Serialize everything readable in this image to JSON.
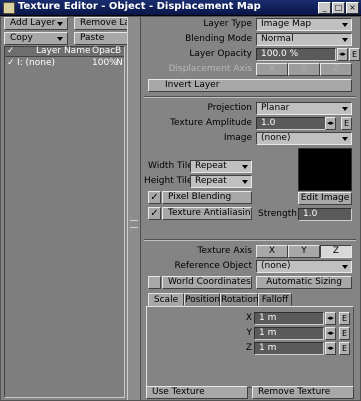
{
  "window": {
    "title": "Texture Editor - Object - Displacement Map",
    "min": "_",
    "max": "□",
    "close": "×"
  },
  "layers": {
    "add_layer": "Add Layer",
    "remove_layer": "Remove Layer",
    "copy": "Copy",
    "paste": "Paste",
    "columns": [
      "Layer Name",
      "Opac",
      "B"
    ],
    "rows": [
      {
        "check": "✓",
        "name": "I: (none)",
        "opacity": "100%",
        "blend": "N"
      }
    ],
    "header_check": "✓"
  },
  "layer_props": {
    "layer_type_label": "Layer Type",
    "layer_type_value": "Image Map",
    "blending_mode_label": "Blending Mode",
    "blending_mode_value": "Normal",
    "layer_opacity_label": "Layer Opacity",
    "layer_opacity_value": "100.0 %",
    "displacement_axis_label": "Displacement Axis",
    "axis_x": "X",
    "axis_y": "Y",
    "axis_z": "Z",
    "invert_layer": "Invert Layer",
    "env": "E"
  },
  "image_props": {
    "projection_label": "Projection",
    "projection_value": "Planar",
    "texture_amplitude_label": "Texture Amplitude",
    "texture_amplitude_value": "1.0",
    "image_label": "Image",
    "image_value": "(none)",
    "width_tile_label": "Width Tile",
    "width_tile_value": "Repeat",
    "height_tile_label": "Height Tile",
    "height_tile_value": "Repeat",
    "pixel_blending": "Pixel Blending",
    "texture_antialiasing": "Texture Antialiasing",
    "pixel_blending_check": "✓",
    "texture_antialiasing_check": "✓",
    "edit_image": "Edit Image",
    "strength_label": "Strength",
    "strength_value": "1.0"
  },
  "axis_props": {
    "texture_axis_label": "Texture Axis",
    "axis_x": "X",
    "axis_y": "Y",
    "axis_z": "Z",
    "reference_object_label": "Reference Object",
    "reference_object_value": "(none)",
    "world_coordinates": "World Coordinates",
    "world_coordinates_check": "",
    "automatic_sizing": "Automatic Sizing",
    "tabs": [
      "Scale",
      "Position",
      "Rotation",
      "Falloff"
    ],
    "scale": [
      {
        "axis": "X",
        "value": "1 m"
      },
      {
        "axis": "Y",
        "value": "1 m"
      },
      {
        "axis": "Z",
        "value": "1 m"
      }
    ]
  },
  "footer": {
    "use_texture": "Use Texture",
    "remove_texture": "Remove Texture"
  }
}
